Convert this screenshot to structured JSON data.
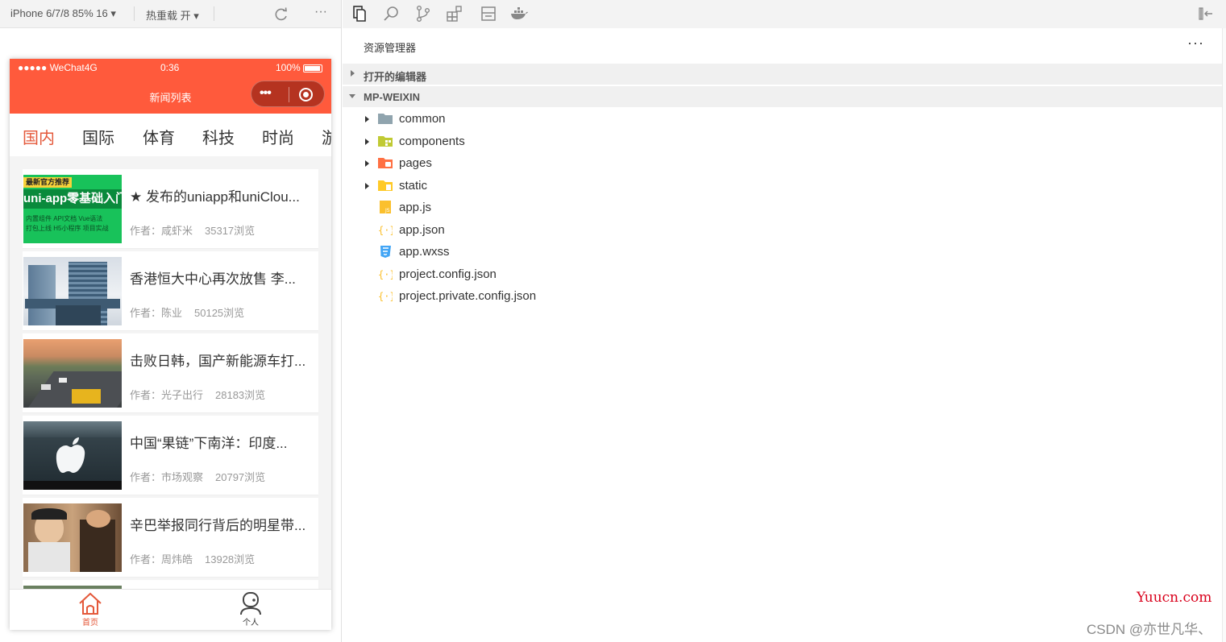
{
  "simulator_toolbar": {
    "device": "iPhone 6/7/8 85% 16 ▾",
    "hot_reload": "热重载 开 ▾",
    "refresh_icon": "refresh-icon",
    "more": "···"
  },
  "phone": {
    "status": {
      "carrier": "●●●●● WeChat4G",
      "time": "0:36",
      "battery": "100%"
    },
    "nav_title": "新闻列表",
    "capsule": {
      "more": "•••",
      "close_icon": "record-icon"
    },
    "tabs": [
      "国内",
      "国际",
      "体育",
      "科技",
      "时尚",
      "游"
    ],
    "active_tab": 0,
    "news": [
      {
        "title": "★ 发布的uniapp和uniClou...",
        "author": "作者：咸虾米",
        "views": "35317浏览",
        "thumb_text_1": "最新官方推荐",
        "thumb_text_2": "uni-app零基础入门",
        "thumb_text_3": "内置组件  API文档  Vue语法",
        "thumb_text_4": "打包上线  H5小程序  项目实战"
      },
      {
        "title": "香港恒大中心再次放售 李...",
        "author": "作者：陈业",
        "views": "50125浏览"
      },
      {
        "title": "击败日韩，国产新能源车打...",
        "author": "作者：光子出行",
        "views": "28183浏览"
      },
      {
        "title": "中国“果链”下南洋：印度...",
        "author": "作者：市场观察",
        "views": "20797浏览"
      },
      {
        "title": "辛巴举报同行背后的明星带...",
        "author": "作者：周炜皓",
        "views": "13928浏览"
      }
    ],
    "tabbar": [
      {
        "label": "首页",
        "icon": "home-icon",
        "active": true
      },
      {
        "label": "个人",
        "icon": "user-icon",
        "active": false
      }
    ],
    "colors": {
      "theme": "#ff5a3c",
      "active_tab": "#e4583a"
    }
  },
  "explorer": {
    "activity_icons": [
      "files-icon",
      "search-icon",
      "source-control-icon",
      "extensions-icon",
      "panel-icon",
      "docker-icon"
    ],
    "collapse_icon": "collapse-panel-icon",
    "title": "资源管理器",
    "more": "···",
    "open_editors": "打开的编辑器",
    "project": "MP-WEIXIN",
    "tree": [
      {
        "name": "common",
        "type": "folder",
        "icon": "folder-icon"
      },
      {
        "name": "components",
        "type": "folder",
        "icon": "folder-components-icon"
      },
      {
        "name": "pages",
        "type": "folder",
        "icon": "folder-pages-icon"
      },
      {
        "name": "static",
        "type": "folder",
        "icon": "folder-static-icon"
      },
      {
        "name": "app.js",
        "type": "file",
        "icon": "js-file-icon"
      },
      {
        "name": "app.json",
        "type": "file",
        "icon": "json-file-icon"
      },
      {
        "name": "app.wxss",
        "type": "file",
        "icon": "css-file-icon"
      },
      {
        "name": "project.config.json",
        "type": "file",
        "icon": "json-file-icon"
      },
      {
        "name": "project.private.config.json",
        "type": "file",
        "icon": "json-file-icon"
      }
    ]
  },
  "watermarks": {
    "yuucn": "Yuucn.com",
    "csdn": "CSDN @亦世凡华、"
  }
}
